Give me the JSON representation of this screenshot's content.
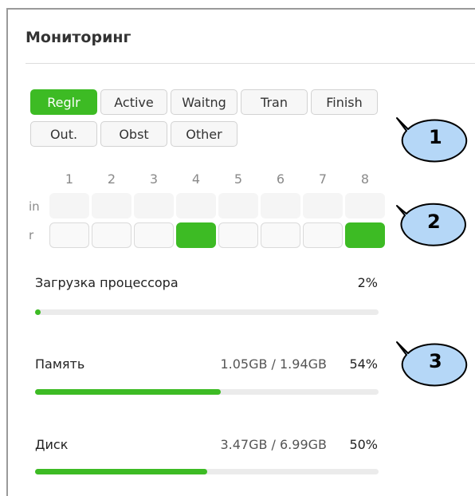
{
  "panel": {
    "title": "Мониторинг"
  },
  "status_buttons": {
    "row1": [
      {
        "label": "Reglr",
        "active": true
      },
      {
        "label": "Active",
        "active": false
      },
      {
        "label": "Waitng",
        "active": false
      },
      {
        "label": "Tran",
        "active": false
      },
      {
        "label": "Finish",
        "active": false
      }
    ],
    "row2": [
      {
        "label": "Out.",
        "active": false
      },
      {
        "label": "Obst",
        "active": false
      },
      {
        "label": "Other",
        "active": false
      }
    ]
  },
  "grid": {
    "columns": [
      "1",
      "2",
      "3",
      "4",
      "5",
      "6",
      "7",
      "8"
    ],
    "row_labels": {
      "in": "in",
      "r": "r"
    },
    "r_active": [
      false,
      false,
      false,
      true,
      false,
      false,
      false,
      true
    ]
  },
  "metrics": {
    "cpu": {
      "label": "Загрузка процессора",
      "detail": "",
      "percent_label": "2%",
      "value": 0.02
    },
    "memory": {
      "label": "Память",
      "detail": "1.05GB / 1.94GB",
      "percent_label": "54%",
      "value": 0.54
    },
    "disk": {
      "label": "Диск",
      "detail": "3.47GB / 6.99GB",
      "percent_label": "50%",
      "value": 0.5
    }
  },
  "callouts": {
    "c1": "1",
    "c2": "2",
    "c3": "3"
  },
  "colors": {
    "accent": "#3dbb24",
    "callout_fill": "#b5d7f7"
  }
}
